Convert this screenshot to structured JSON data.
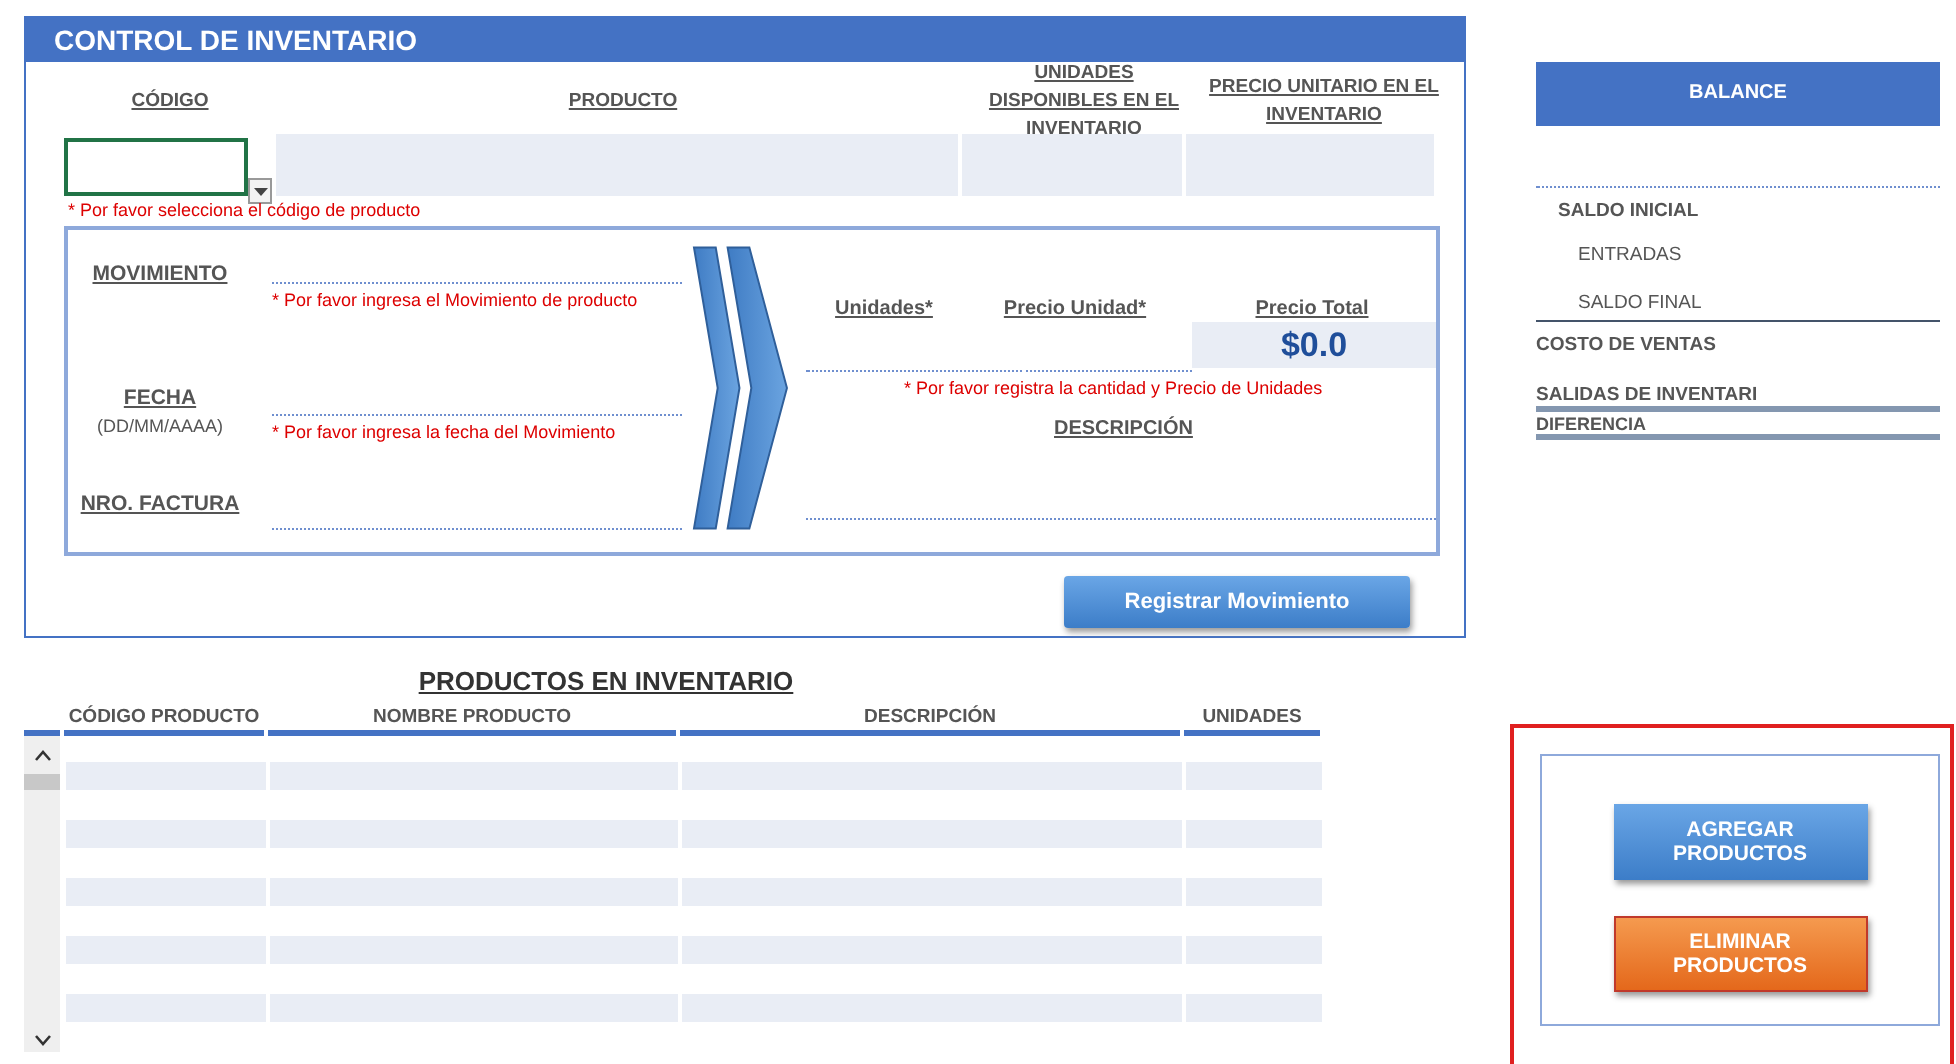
{
  "control": {
    "title": "CONTROL DE INVENTARIO",
    "columns": [
      "CÓDIGO",
      "PRODUCTO",
      "UNIDADES DISPONIBLES EN EL INVENTARIO",
      "PRECIO UNITARIO EN EL INVENTARIO"
    ],
    "code_hint": "* Por favor selecciona el código de producto",
    "fields": [
      {
        "label": "MOVIMIENTO",
        "hint": "* Por favor ingresa el Movimiento de producto"
      },
      {
        "label": "FECHA",
        "sublabel": "(DD/MM/AAAA)",
        "hint": "* Por favor ingresa la fecha del Movimiento"
      },
      {
        "label": "NRO. FACTURA"
      }
    ],
    "amounts": {
      "headers": [
        "Unidades*",
        "Precio Unidad*",
        "Precio Total"
      ],
      "total": "$0.0",
      "hint": "* Por favor registra la cantidad y Precio de Unidades",
      "description_label": "DESCRIPCIÓN"
    },
    "register_button": "Registrar Movimiento"
  },
  "balance": {
    "title": "BALANCE",
    "items": [
      {
        "label": "SALDO INICIAL",
        "kind": "main"
      },
      {
        "label": "ENTRADAS",
        "kind": "sub"
      },
      {
        "label": "SALDO FINAL",
        "kind": "sub"
      },
      {
        "label": "COSTO DE VENTAS",
        "kind": "main"
      },
      {
        "label": "SALIDAS DE INVENTARI",
        "kind": "main"
      },
      {
        "label": "DIFERENCIA",
        "kind": "small"
      }
    ]
  },
  "inventory": {
    "title": "PRODUCTOS EN INVENTARIO",
    "columns": [
      "CÓDIGO PRODUCTO",
      "NOMBRE PRODUCTO",
      "DESCRIPCIÓN",
      "UNIDADES"
    ]
  },
  "actions": [
    {
      "label": "AGREGAR PRODUCTOS",
      "kind": "add"
    },
    {
      "label": "ELIMINAR PRODUCTOS",
      "kind": "delete"
    }
  ]
}
